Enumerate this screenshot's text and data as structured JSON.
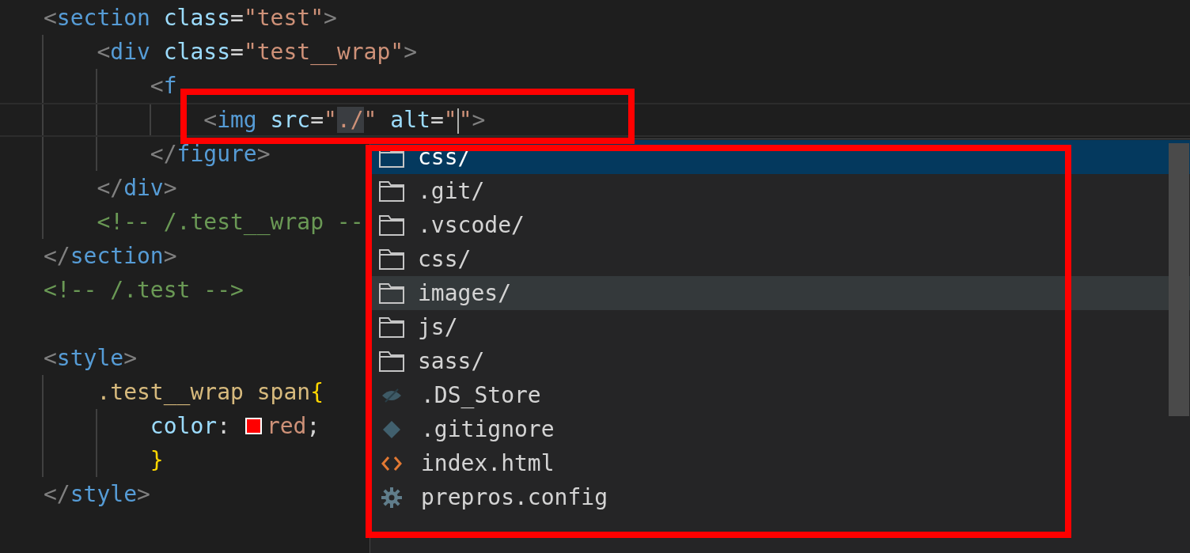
{
  "editor": {
    "lines": [
      {
        "kind": "code",
        "current": false,
        "tokens": [
          {
            "kind": "p",
            "text": "<"
          },
          {
            "kind": "tag",
            "text": "section"
          },
          {
            "kind": "attr",
            "text": " class"
          },
          {
            "kind": "plain",
            "text": "="
          },
          {
            "kind": "str",
            "text": "\"test\""
          },
          {
            "kind": "p",
            "text": ">"
          }
        ]
      },
      {
        "kind": "code",
        "current": false,
        "tokens": [
          {
            "kind": "p",
            "text": "    <"
          },
          {
            "kind": "tag",
            "text": "div"
          },
          {
            "kind": "attr",
            "text": " class"
          },
          {
            "kind": "plain",
            "text": "="
          },
          {
            "kind": "str",
            "text": "\"test__wrap\""
          },
          {
            "kind": "p",
            "text": ">"
          }
        ]
      },
      {
        "kind": "code",
        "current": false,
        "tokens": [
          {
            "kind": "p",
            "text": "        <"
          },
          {
            "kind": "tag",
            "text": "f"
          }
        ]
      },
      {
        "kind": "code",
        "current": true,
        "tokens": [
          {
            "kind": "p",
            "text": "            <"
          },
          {
            "kind": "tag",
            "text": "img"
          },
          {
            "kind": "attr",
            "text": " src"
          },
          {
            "kind": "plain",
            "text": "="
          },
          {
            "kind": "str",
            "text": "\""
          },
          {
            "kind": "str",
            "text": "./",
            "highlighted": true
          },
          {
            "kind": "str",
            "text": "\""
          },
          {
            "kind": "attr",
            "text": " alt"
          },
          {
            "kind": "plain",
            "text": "="
          },
          {
            "kind": "str",
            "text": "\""
          },
          {
            "kind": "cursor"
          },
          {
            "kind": "str",
            "text": "\""
          },
          {
            "kind": "p",
            "text": ">"
          }
        ]
      },
      {
        "kind": "code",
        "current": false,
        "tokens": [
          {
            "kind": "p",
            "text": "        </"
          },
          {
            "kind": "tag",
            "text": "figure"
          },
          {
            "kind": "p",
            "text": ">"
          }
        ]
      },
      {
        "kind": "code",
        "current": false,
        "tokens": [
          {
            "kind": "p",
            "text": "    </"
          },
          {
            "kind": "tag",
            "text": "div"
          },
          {
            "kind": "p",
            "text": ">"
          }
        ]
      },
      {
        "kind": "code",
        "current": false,
        "tokens": [
          {
            "kind": "cmt",
            "text": "    <!-- /.test__wrap --"
          }
        ]
      },
      {
        "kind": "code",
        "current": false,
        "tokens": [
          {
            "kind": "p",
            "text": "</"
          },
          {
            "kind": "tag",
            "text": "section"
          },
          {
            "kind": "p",
            "text": ">"
          }
        ]
      },
      {
        "kind": "code",
        "current": false,
        "tokens": [
          {
            "kind": "cmt",
            "text": "<!-- /.test -->"
          }
        ]
      },
      {
        "kind": "blank"
      },
      {
        "kind": "code",
        "current": false,
        "tokens": [
          {
            "kind": "p",
            "text": "<"
          },
          {
            "kind": "tag",
            "text": "style"
          },
          {
            "kind": "p",
            "text": ">"
          }
        ]
      },
      {
        "kind": "code",
        "current": false,
        "tokens": [
          {
            "kind": "sel",
            "text": "    .test__wrap span"
          },
          {
            "kind": "brace",
            "text": "{"
          }
        ]
      },
      {
        "kind": "code",
        "current": false,
        "tokens": [
          {
            "kind": "prop",
            "text": "        color"
          },
          {
            "kind": "plain",
            "text": ": "
          },
          {
            "kind": "swatch",
            "color": "#ff0000"
          },
          {
            "kind": "val",
            "text": "red"
          },
          {
            "kind": "plain",
            "text": ";"
          }
        ]
      },
      {
        "kind": "code",
        "current": false,
        "tokens": [
          {
            "kind": "brace",
            "text": "        }"
          }
        ]
      },
      {
        "kind": "code",
        "current": false,
        "tokens": [
          {
            "kind": "p",
            "text": "</"
          },
          {
            "kind": "tag",
            "text": "style"
          },
          {
            "kind": "p",
            "text": ">"
          }
        ]
      }
    ]
  },
  "suggestions": {
    "items": [
      {
        "label": "css/",
        "kind": "folder",
        "selected": true,
        "hovered": false
      },
      {
        "label": ".git/",
        "kind": "folder",
        "selected": false,
        "hovered": false
      },
      {
        "label": ".vscode/",
        "kind": "folder",
        "selected": false,
        "hovered": false
      },
      {
        "label": "css/",
        "kind": "folder",
        "selected": false,
        "hovered": false
      },
      {
        "label": "images/",
        "kind": "folder",
        "selected": false,
        "hovered": true
      },
      {
        "label": "js/",
        "kind": "folder",
        "selected": false,
        "hovered": false
      },
      {
        "label": "sass/",
        "kind": "folder",
        "selected": false,
        "hovered": false
      },
      {
        "label": ".DS_Store",
        "kind": "hidden",
        "selected": false,
        "hovered": false
      },
      {
        "label": ".gitignore",
        "kind": "git",
        "selected": false,
        "hovered": false
      },
      {
        "label": "index.html",
        "kind": "html",
        "selected": false,
        "hovered": false
      },
      {
        "label": "prepros.config",
        "kind": "config",
        "selected": false,
        "hovered": false
      }
    ]
  },
  "annotations": [
    {
      "kind": "box"
    },
    {
      "kind": "box"
    }
  ]
}
